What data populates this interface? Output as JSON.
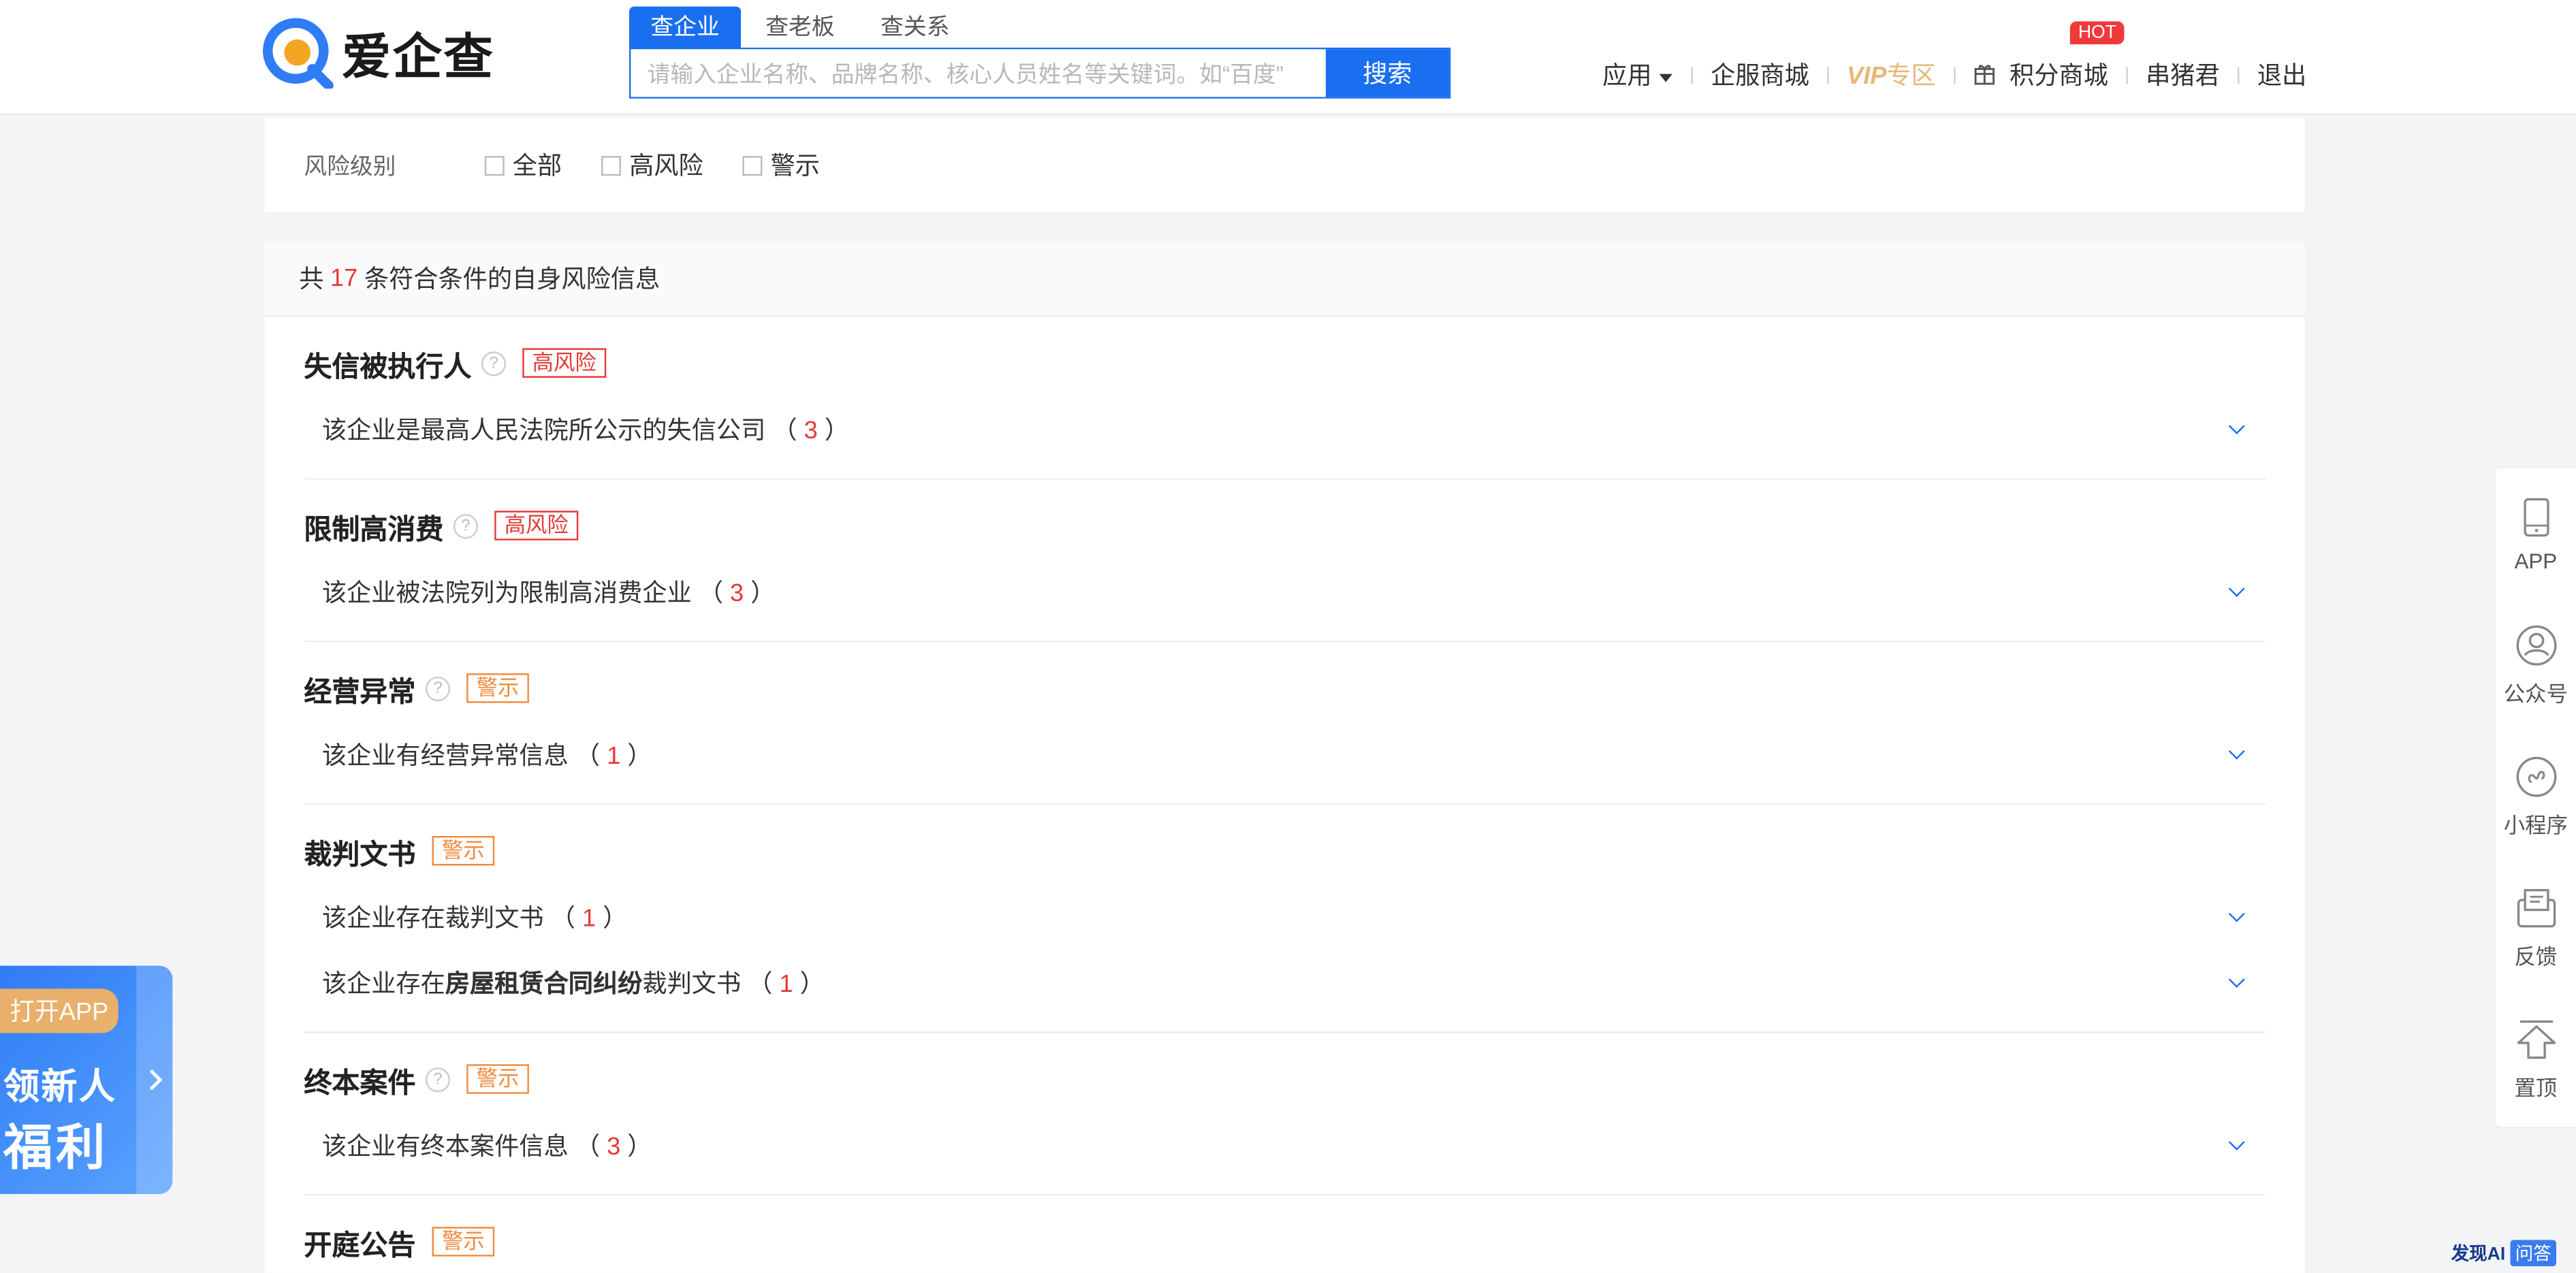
{
  "header": {
    "logo_text": "爱企查",
    "search_tabs": [
      "查企业",
      "查老板",
      "查关系"
    ],
    "search_placeholder": "请输入企业名称、品牌名称、核心人员姓名等关键词。如“百度”",
    "search_button": "搜索",
    "nav": {
      "apps": "应用",
      "mall": "企服商城",
      "vip": "VIP",
      "vip_sub": "专区",
      "points": "积分商城",
      "hot": "HOT",
      "user": "串猪君",
      "logout": "退出"
    }
  },
  "filter": {
    "label": "风险级别",
    "options": [
      "全部",
      "高风险",
      "警示"
    ]
  },
  "results": {
    "prefix": "共",
    "count": "17",
    "suffix": "条符合条件的自身风险信息",
    "categories": [
      {
        "name": "失信被执行人",
        "tag": "高风险",
        "rows": [
          {
            "pre": "该企业是最高人民法院所公示的失信公司",
            "bold": "",
            "post": "",
            "count": "3"
          }
        ]
      },
      {
        "name": "限制高消费",
        "tag": "高风险",
        "rows": [
          {
            "pre": "该企业被法院列为限制高消费企业",
            "bold": "",
            "post": "",
            "count": "3"
          }
        ]
      },
      {
        "name": "经营异常",
        "tag": "警示",
        "rows": [
          {
            "pre": "该企业有经营异常信息",
            "bold": "",
            "post": "",
            "count": "1"
          }
        ]
      },
      {
        "name": "裁判文书",
        "tag": "警示",
        "rows": [
          {
            "pre": "该企业存在裁判文书",
            "bold": "",
            "post": "",
            "count": "1"
          },
          {
            "pre": "该企业存在",
            "bold": "房屋租赁合同纠纷",
            "post": "裁判文书",
            "count": "1"
          }
        ]
      },
      {
        "name": "终本案件",
        "tag": "警示",
        "rows": [
          {
            "pre": "该企业有终本案件信息",
            "bold": "",
            "post": "",
            "count": "3"
          }
        ]
      },
      {
        "name": "开庭公告",
        "tag": "警示",
        "rows": []
      }
    ]
  },
  "right_bar": [
    "APP",
    "公众号",
    "小程序",
    "反馈",
    "置顶"
  ],
  "promo": {
    "tab": "打开APP",
    "line1": "领新人",
    "line2": "福利"
  },
  "corner": {
    "brand": "发现AI",
    "badge": "问答"
  }
}
